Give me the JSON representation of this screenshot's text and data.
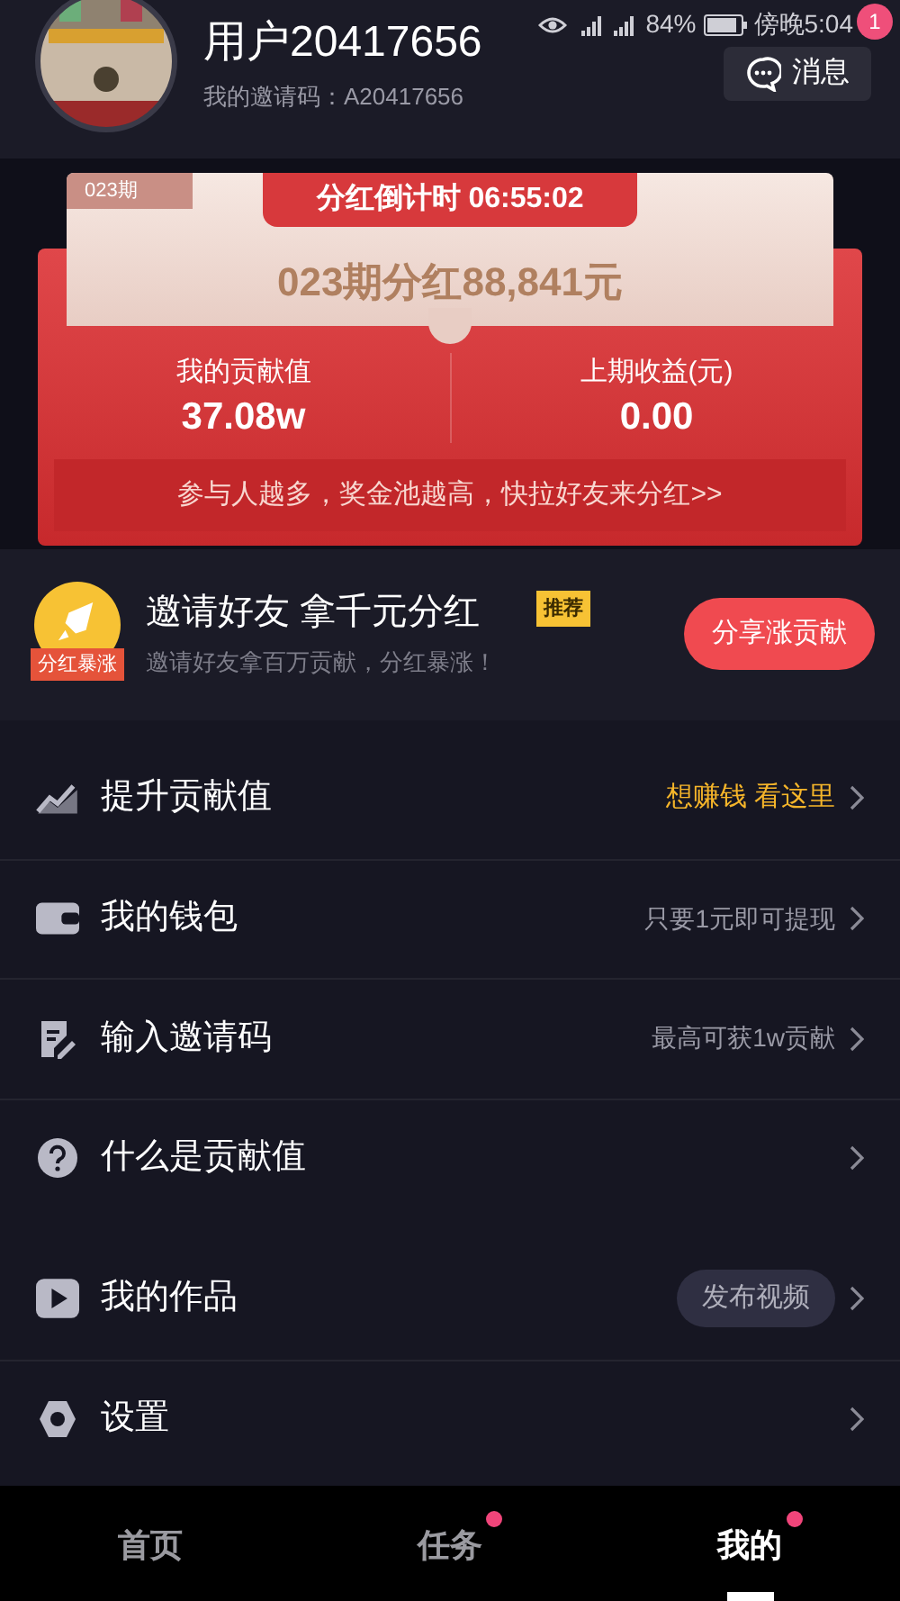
{
  "status_bar": {
    "battery": "84%",
    "time": "傍晚5:04"
  },
  "profile": {
    "name": "用户20417656",
    "invite_code": "我的邀请码：A20417656",
    "message_button": "消息",
    "message_count": "1"
  },
  "dividend": {
    "period_tag": "023期",
    "countdown": "分红倒计时 06:55:02",
    "title": "023期分红**88,841元**",
    "stats": [
      {
        "label": "我的贡献值",
        "value": "37.08w"
      },
      {
        "label": "上期收益(元)",
        "value": "0.00"
      }
    ],
    "banner": "参与人越多，奖金池越高，快拉好友来分红>>"
  },
  "invite": {
    "icon_label": "分红暴涨",
    "title": "邀请好友 拿千元分红",
    "tag": "推荐",
    "subtitle": "邀请好友拿百万贡献，分红暴涨！",
    "button": "分享涨贡献"
  },
  "menu_groups": [
    [
      {
        "kind": "chart",
        "label": "提升贡献值",
        "right": {
          "kind": "highlight",
          "text": "想赚钱 看这里"
        }
      },
      {
        "kind": "wallet",
        "label": "我的钱包",
        "right": {
          "kind": "text",
          "text": "只要1元即可提现"
        }
      },
      {
        "kind": "edit",
        "label": "输入邀请码",
        "right": {
          "kind": "text",
          "text": "最高可获1w贡献"
        }
      },
      {
        "kind": "question",
        "label": "什么是贡献值"
      }
    ],
    [
      {
        "kind": "play",
        "label": "我的作品",
        "right": {
          "kind": "button",
          "text": "发布视频"
        }
      },
      {
        "kind": "gear",
        "label": "设置"
      }
    ]
  ],
  "tabs": [
    {
      "label": "首页",
      "selected": false,
      "dot": false
    },
    {
      "label": "任务",
      "selected": false,
      "dot": true
    },
    {
      "label": "我的",
      "selected": true,
      "dot": true
    }
  ]
}
